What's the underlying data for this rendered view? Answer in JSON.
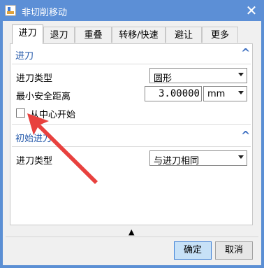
{
  "window": {
    "title": "非切削移动",
    "close_glyph": "✕"
  },
  "tabs": [
    {
      "label": "进刀",
      "active": true
    },
    {
      "label": "退刀"
    },
    {
      "label": "重叠"
    },
    {
      "label": "转移/快速"
    },
    {
      "label": "避让"
    },
    {
      "label": "更多"
    }
  ],
  "sections": {
    "engage": {
      "title": "进刀",
      "type_label": "进刀类型",
      "type_value": "圆形",
      "min_clearance_label": "最小安全距离",
      "min_clearance_value": "3.00000",
      "unit_value": "mm",
      "start_center_label": "从中心开始",
      "start_center_checked": false
    },
    "initial": {
      "title": "初始进刀",
      "type_label": "进刀类型",
      "type_value": "与进刀相同"
    }
  },
  "footer": {
    "ok_label": "确定",
    "cancel_label": "取消",
    "expand_glyph": "▲"
  },
  "colors": {
    "titlebar": "#5c8fd6",
    "section_title": "#1f55a8",
    "annotation_arrow": "#e8413e",
    "primary_button": "#c7e1f7"
  }
}
